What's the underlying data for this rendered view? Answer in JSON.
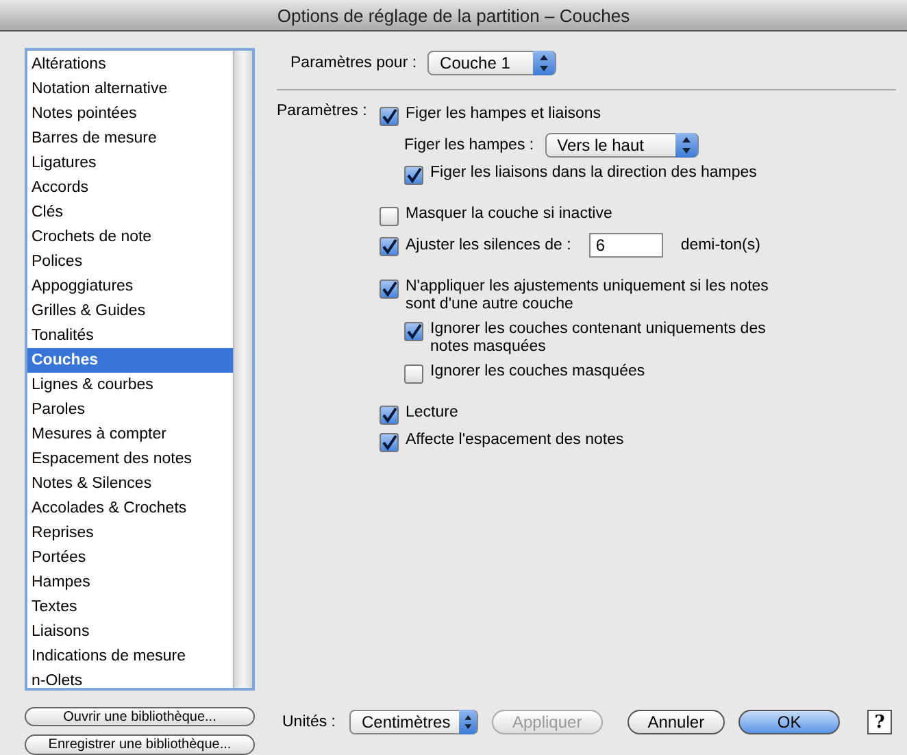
{
  "window": {
    "title": "Options de réglage de la partition – Couches"
  },
  "sidebar": {
    "items": [
      {
        "label": "Altérations",
        "selected": false
      },
      {
        "label": "Notation alternative",
        "selected": false
      },
      {
        "label": "Notes pointées",
        "selected": false
      },
      {
        "label": "Barres de mesure",
        "selected": false
      },
      {
        "label": "Ligatures",
        "selected": false
      },
      {
        "label": "Accords",
        "selected": false
      },
      {
        "label": "Clés",
        "selected": false
      },
      {
        "label": "Crochets de note",
        "selected": false
      },
      {
        "label": "Polices",
        "selected": false
      },
      {
        "label": "Appoggiatures",
        "selected": false
      },
      {
        "label": "Grilles & Guides",
        "selected": false
      },
      {
        "label": "Tonalités",
        "selected": false
      },
      {
        "label": "Couches",
        "selected": true
      },
      {
        "label": "Lignes & courbes",
        "selected": false
      },
      {
        "label": "Paroles",
        "selected": false
      },
      {
        "label": "Mesures à compter",
        "selected": false
      },
      {
        "label": "Espacement des notes",
        "selected": false
      },
      {
        "label": "Notes & Silences",
        "selected": false
      },
      {
        "label": "Accolades & Crochets",
        "selected": false
      },
      {
        "label": "Reprises",
        "selected": false
      },
      {
        "label": "Portées",
        "selected": false
      },
      {
        "label": "Hampes",
        "selected": false
      },
      {
        "label": "Textes",
        "selected": false
      },
      {
        "label": "Liaisons",
        "selected": false
      },
      {
        "label": "Indications de mesure",
        "selected": false
      },
      {
        "label": "n-Olets",
        "selected": false
      }
    ],
    "buttons": [
      "Ouvrir une bibliothèque...",
      "Enregistrer une bibliothèque..."
    ]
  },
  "layer_select": {
    "label": "Paramètres pour :",
    "value": "Couche 1"
  },
  "parameters": {
    "label": "Paramètres :",
    "options": [
      {
        "kind": "checkbox",
        "label": "Figer les hampes et liaisons",
        "checked": true,
        "children": [
          {
            "kind": "select",
            "label": "Figer les hampes :",
            "value": "Vers le haut"
          },
          {
            "kind": "checkbox",
            "label": "Figer les liaisons dans la direction des hampes",
            "checked": true
          }
        ]
      },
      {
        "kind": "checkbox",
        "label": "Masquer la couche si inactive",
        "checked": false
      },
      {
        "kind": "field",
        "label": "Ajuster les silences de :",
        "checked": true,
        "value": "6",
        "unit": "demi-ton(s)"
      },
      {
        "kind": "checkbox",
        "label": "N'appliquer les ajustements uniquement si les notes sont d'une autre couche",
        "checked": true,
        "children": [
          {
            "kind": "checkbox",
            "label": "Ignorer les couches contenant uniquements des notes masquées",
            "checked": true
          },
          {
            "kind": "checkbox",
            "label": "Ignorer les couches masquées",
            "checked": false
          }
        ]
      },
      {
        "kind": "checkbox",
        "label": "Lecture",
        "checked": true
      },
      {
        "kind": "checkbox",
        "label": "Affecte l'espacement des notes",
        "checked": true
      }
    ]
  },
  "footer": {
    "units_label": "Unités :",
    "units_value": "Centimètres",
    "buttons": [
      {
        "label": "Appliquer",
        "kind": "normal",
        "disabled": true
      },
      {
        "label": "Annuler",
        "kind": "normal",
        "disabled": false
      },
      {
        "label": "OK",
        "kind": "default",
        "disabled": false
      }
    ],
    "help": "?"
  }
}
